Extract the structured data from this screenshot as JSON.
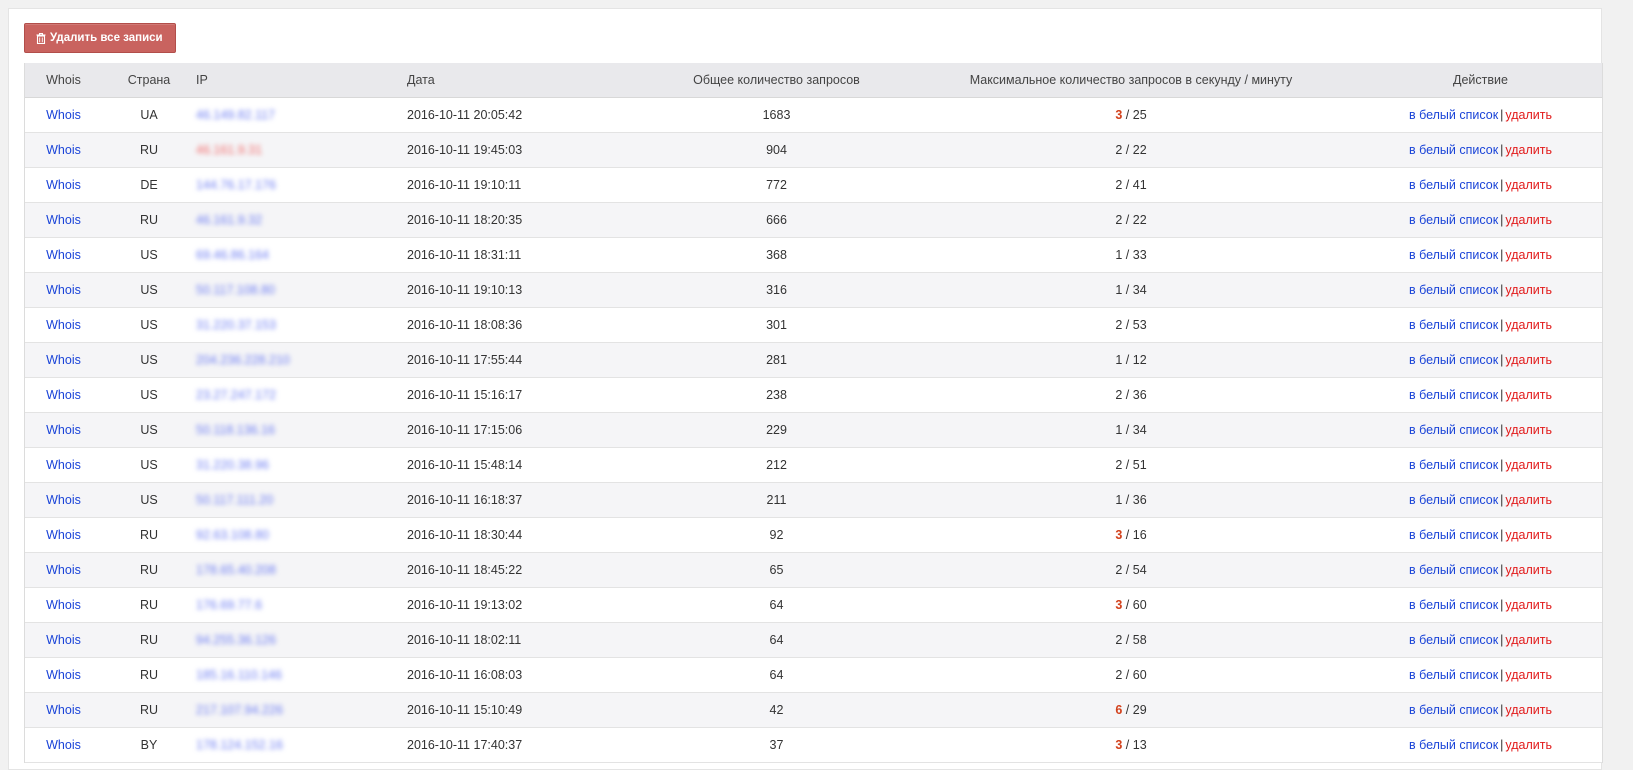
{
  "toolbar": {
    "delete_all_label": "Удалить все записи",
    "delete_icon": "trash-icon"
  },
  "table": {
    "headers": {
      "whois": "Whois",
      "country": "Страна",
      "ip": "IP",
      "date": "Дата",
      "total": "Общее количество запросов",
      "max": "Максимальное количество запросов в секунду / минуту",
      "action": "Действие"
    },
    "rows": [
      {
        "whois": "Whois",
        "country": "UA",
        "ip": "46.149.82.117",
        "ip_warn": false,
        "date": "2016-10-11 20:05:42",
        "total": "1683",
        "per_sec": "3",
        "per_min": "25",
        "highlight": true
      },
      {
        "whois": "Whois",
        "country": "RU",
        "ip": "46.161.9.31",
        "ip_warn": true,
        "date": "2016-10-11 19:45:03",
        "total": "904",
        "per_sec": "2",
        "per_min": "22",
        "highlight": false
      },
      {
        "whois": "Whois",
        "country": "DE",
        "ip": "144.76.17.176",
        "ip_warn": false,
        "date": "2016-10-11 19:10:11",
        "total": "772",
        "per_sec": "2",
        "per_min": "41",
        "highlight": false
      },
      {
        "whois": "Whois",
        "country": "RU",
        "ip": "46.161.9.32",
        "ip_warn": false,
        "date": "2016-10-11 18:20:35",
        "total": "666",
        "per_sec": "2",
        "per_min": "22",
        "highlight": false
      },
      {
        "whois": "Whois",
        "country": "US",
        "ip": "69.46.86.164",
        "ip_warn": false,
        "date": "2016-10-11 18:31:11",
        "total": "368",
        "per_sec": "1",
        "per_min": "33",
        "highlight": false
      },
      {
        "whois": "Whois",
        "country": "US",
        "ip": "50.117.108.80",
        "ip_warn": false,
        "date": "2016-10-11 19:10:13",
        "total": "316",
        "per_sec": "1",
        "per_min": "34",
        "highlight": false
      },
      {
        "whois": "Whois",
        "country": "US",
        "ip": "31.220.37.153",
        "ip_warn": false,
        "date": "2016-10-11 18:08:36",
        "total": "301",
        "per_sec": "2",
        "per_min": "53",
        "highlight": false
      },
      {
        "whois": "Whois",
        "country": "US",
        "ip": "204.236.228.210",
        "ip_warn": false,
        "date": "2016-10-11 17:55:44",
        "total": "281",
        "per_sec": "1",
        "per_min": "12",
        "highlight": false
      },
      {
        "whois": "Whois",
        "country": "US",
        "ip": "23.27.247.172",
        "ip_warn": false,
        "date": "2016-10-11 15:16:17",
        "total": "238",
        "per_sec": "2",
        "per_min": "36",
        "highlight": false
      },
      {
        "whois": "Whois",
        "country": "US",
        "ip": "50.118.136.16",
        "ip_warn": false,
        "date": "2016-10-11 17:15:06",
        "total": "229",
        "per_sec": "1",
        "per_min": "34",
        "highlight": false
      },
      {
        "whois": "Whois",
        "country": "US",
        "ip": "31.220.38.96",
        "ip_warn": false,
        "date": "2016-10-11 15:48:14",
        "total": "212",
        "per_sec": "2",
        "per_min": "51",
        "highlight": false
      },
      {
        "whois": "Whois",
        "country": "US",
        "ip": "50.117.111.20",
        "ip_warn": false,
        "date": "2016-10-11 16:18:37",
        "total": "211",
        "per_sec": "1",
        "per_min": "36",
        "highlight": false
      },
      {
        "whois": "Whois",
        "country": "RU",
        "ip": "92.63.108.80",
        "ip_warn": false,
        "date": "2016-10-11 18:30:44",
        "total": "92",
        "per_sec": "3",
        "per_min": "16",
        "highlight": true
      },
      {
        "whois": "Whois",
        "country": "RU",
        "ip": "178.65.40.208",
        "ip_warn": false,
        "date": "2016-10-11 18:45:22",
        "total": "65",
        "per_sec": "2",
        "per_min": "54",
        "highlight": false
      },
      {
        "whois": "Whois",
        "country": "RU",
        "ip": "176.69.77.6",
        "ip_warn": false,
        "date": "2016-10-11 19:13:02",
        "total": "64",
        "per_sec": "3",
        "per_min": "60",
        "highlight": true
      },
      {
        "whois": "Whois",
        "country": "RU",
        "ip": "94.255.36.126",
        "ip_warn": false,
        "date": "2016-10-11 18:02:11",
        "total": "64",
        "per_sec": "2",
        "per_min": "58",
        "highlight": false
      },
      {
        "whois": "Whois",
        "country": "RU",
        "ip": "185.16.110.146",
        "ip_warn": false,
        "date": "2016-10-11 16:08:03",
        "total": "64",
        "per_sec": "2",
        "per_min": "60",
        "highlight": false
      },
      {
        "whois": "Whois",
        "country": "RU",
        "ip": "217.107.94.226",
        "ip_warn": false,
        "date": "2016-10-11 15:10:49",
        "total": "42",
        "per_sec": "6",
        "per_min": "29",
        "highlight": true
      },
      {
        "whois": "Whois",
        "country": "BY",
        "ip": "178.124.152.16",
        "ip_warn": false,
        "date": "2016-10-11 17:40:37",
        "total": "37",
        "per_sec": "3",
        "per_min": "13",
        "highlight": true
      }
    ],
    "actions": {
      "whitelist_label": "в белый список",
      "separator": "|",
      "delete_label": "удалить"
    },
    "max_separator": "/"
  },
  "colors": {
    "link": "#1a44d8",
    "delete": "#e21a1a",
    "highlight": "#d2401b",
    "button": "#c9635f"
  }
}
